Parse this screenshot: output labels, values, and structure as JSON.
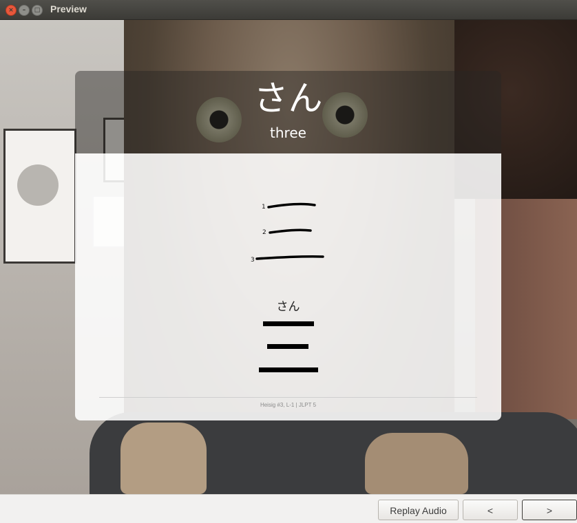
{
  "window": {
    "title": "Preview"
  },
  "card": {
    "kana": "さん",
    "meaning": "three",
    "stroke_numbers": [
      "1",
      "2",
      "3"
    ],
    "reading": "さん",
    "footer": "Heisig #3, L-1 | JLPT 5"
  },
  "buttons": {
    "replay_audio": "Replay Audio",
    "previous": "<",
    "next": ">"
  },
  "colors": {
    "close": "#e9573b",
    "titlebar": "#3c3b37"
  }
}
